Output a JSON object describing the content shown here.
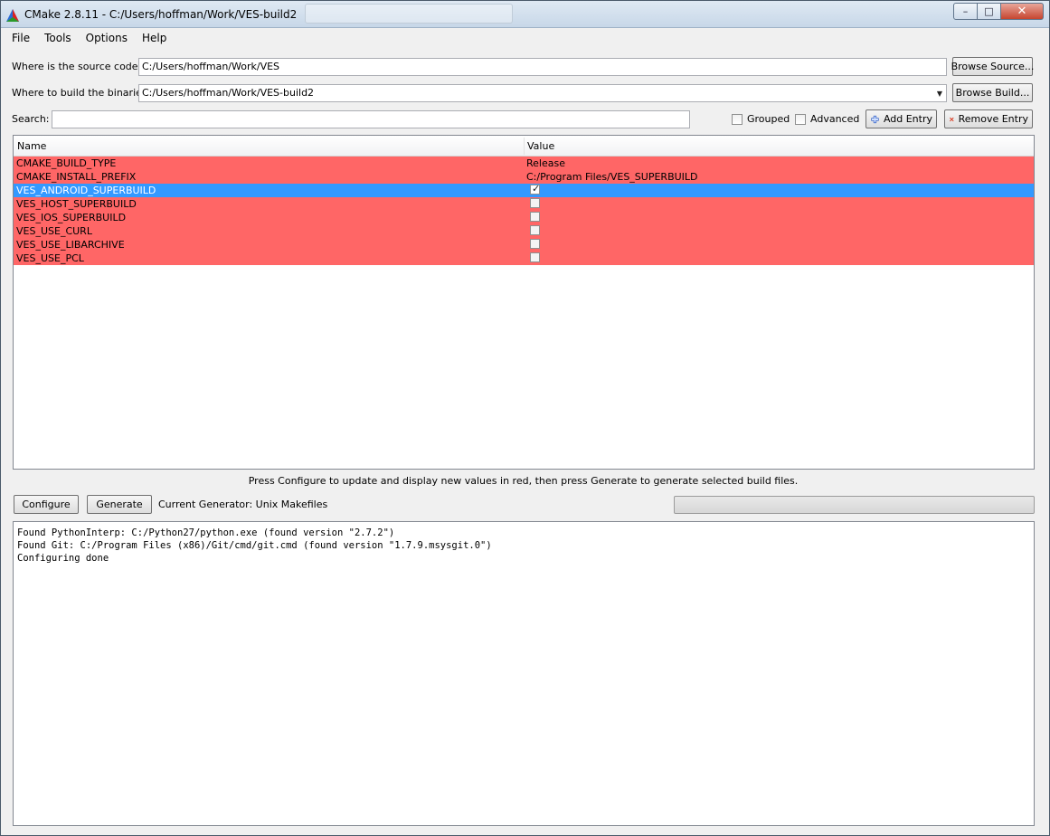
{
  "window": {
    "title": "CMake 2.8.11 - C:/Users/hoffman/Work/VES-build2",
    "minimize_glyph": "–",
    "maximize_glyph": "□",
    "close_glyph": "✕"
  },
  "menu": [
    "File",
    "Tools",
    "Options",
    "Help"
  ],
  "source": {
    "label": "Where is the source code:",
    "value": "C:/Users/hoffman/Work/VES",
    "browse_label": "Browse Source..."
  },
  "binaries": {
    "label": "Where to build the binaries:",
    "value": "C:/Users/hoffman/Work/VES-build2",
    "browse_label": "Browse Build..."
  },
  "search": {
    "label": "Search:",
    "value": ""
  },
  "options": {
    "grouped_label": "Grouped",
    "grouped_checked": false,
    "advanced_label": "Advanced",
    "advanced_checked": false,
    "add_entry_label": "Add Entry",
    "remove_entry_label": "Remove Entry"
  },
  "table": {
    "columns": [
      "Name",
      "Value"
    ],
    "rows": [
      {
        "name": "CMAKE_BUILD_TYPE",
        "value": "Release"
      },
      {
        "name": "CMAKE_INSTALL_PREFIX",
        "value": "C:/Program Files/VES_SUPERBUILD"
      },
      {
        "name": "VES_ANDROID_SUPERBUILD",
        "checked": true,
        "selected": true
      },
      {
        "name": "VES_HOST_SUPERBUILD",
        "checked": false
      },
      {
        "name": "VES_IOS_SUPERBUILD",
        "checked": false
      },
      {
        "name": "VES_USE_CURL",
        "checked": false
      },
      {
        "name": "VES_USE_LIBARCHIVE",
        "checked": false
      },
      {
        "name": "VES_USE_PCL",
        "checked": false
      }
    ]
  },
  "hint": "Press Configure to update and display new values in red, then press Generate to generate selected build files.",
  "actions": {
    "configure_label": "Configure",
    "generate_label": "Generate",
    "generator_text": "Current Generator: Unix Makefiles",
    "progress": 0
  },
  "log": [
    "Found PythonInterp: C:/Python27/python.exe (found version \"2.7.2\")",
    "Found Git: C:/Program Files (x86)/Git/cmd/git.cmd (found version \"1.7.9.msysgit.0\")",
    "Configuring done"
  ],
  "colors": {
    "changed_row": "#ff6666",
    "selected_row": "#3399ff"
  }
}
